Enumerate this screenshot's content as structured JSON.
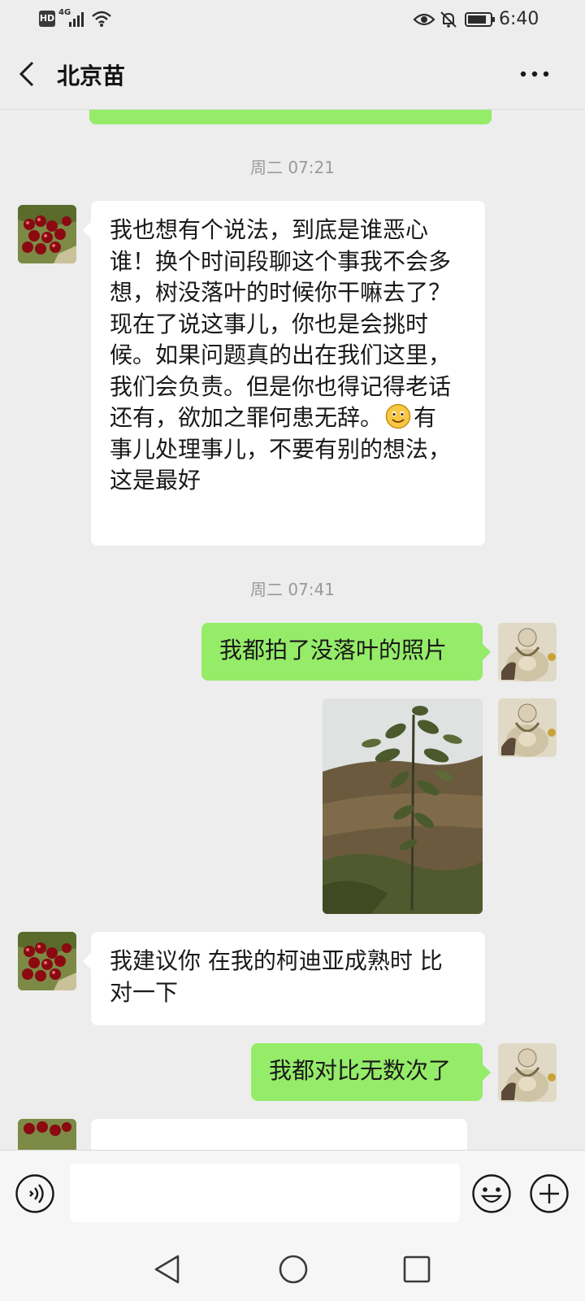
{
  "status_bar": {
    "network_hd": "HD",
    "network_type": "4G",
    "time": "6:40"
  },
  "header": {
    "back_icon": "chevron-left-icon",
    "title": "北京苗",
    "more_icon": "more-dots-icon"
  },
  "chat": {
    "timestamps": [
      "周二 07:21",
      "周二 07:41"
    ],
    "messages": [
      {
        "from": "contact",
        "lines": [
          "我也想有个说法，到底是谁恶心",
          "谁！换个时间段聊这个事我不会多",
          "想，树没落叶的时候你干嘛去了？",
          "现在了说这事儿，你也是会挑时",
          "候。如果问题真的出在我们这里，",
          "我们会负责。但是你也得记得老话",
          "还有，欲加之罪何患无辞。",
          "事儿处理事儿，不要有别的想法，",
          "这是最好"
        ],
        "line7_tail": "有",
        "emoji": "smile-emoji-icon"
      },
      {
        "from": "me",
        "text": "我都拍了没落叶的照片"
      },
      {
        "from": "me",
        "type": "image",
        "image": "tree-photo"
      },
      {
        "from": "contact",
        "lines": [
          "我建议你 在我的柯迪亚成熟时 比",
          "对一下"
        ]
      },
      {
        "from": "me",
        "text": "我都对比无数次了"
      }
    ]
  },
  "input_bar": {
    "voice_icon": "voice-input-icon",
    "emoji_icon": "emoji-icon",
    "plus_icon": "plus-icon"
  },
  "nav_bar": {
    "back_icon": "triangle-back-icon",
    "home_icon": "circle-home-icon",
    "recents_icon": "square-recents-icon"
  },
  "colors": {
    "background": "#ededed",
    "outgoing_bubble": "#95ec69",
    "incoming_bubble": "#ffffff",
    "timestamp": "#9a9a9a"
  }
}
